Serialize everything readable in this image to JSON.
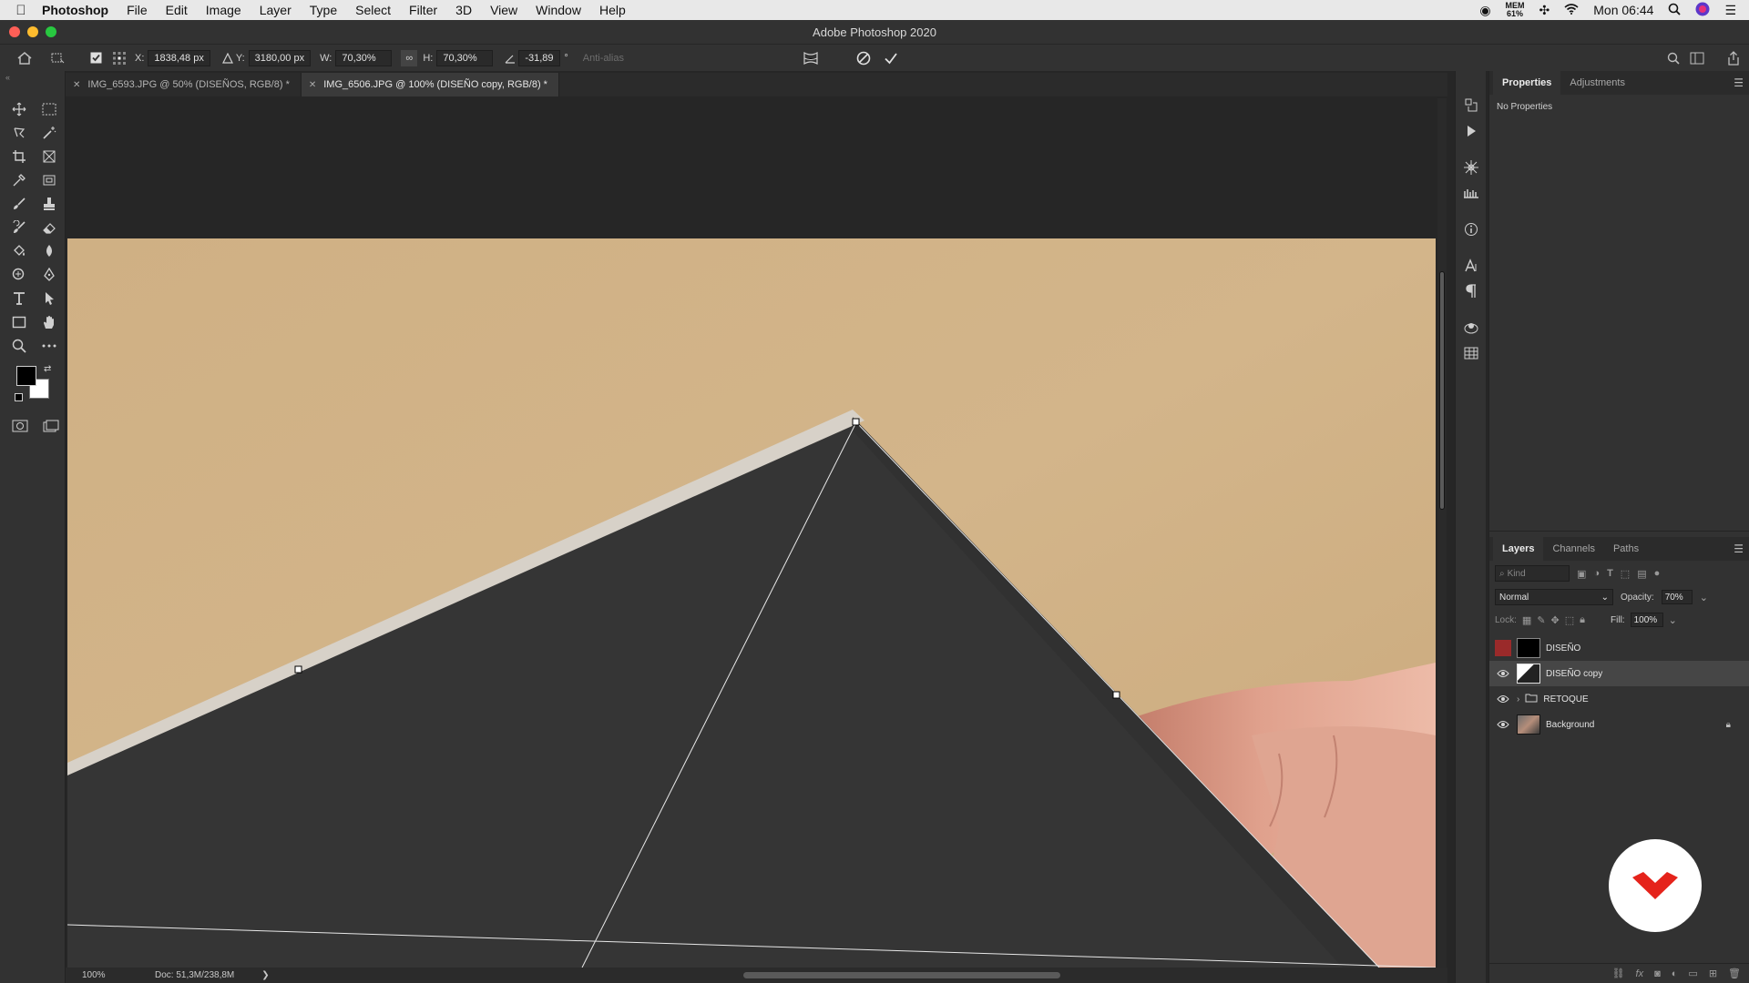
{
  "menubar": {
    "app_name": "Photoshop",
    "items": [
      "File",
      "Edit",
      "Image",
      "Layer",
      "Type",
      "Select",
      "Filter",
      "3D",
      "View",
      "Window",
      "Help"
    ],
    "mem_label": "MEM",
    "mem_value": "61%",
    "clock": "Mon 06:44"
  },
  "window": {
    "title": "Adobe Photoshop 2020"
  },
  "options": {
    "x_label": "X:",
    "x_value": "1838,48 px",
    "y_label": "Y:",
    "y_value": "3180,00 px",
    "w_label": "W:",
    "w_value": "70,30%",
    "h_label": "H:",
    "h_value": "70,30%",
    "angle_value": "-31,89",
    "angle_unit": "°",
    "antialias": "Anti-alias"
  },
  "tabs": [
    {
      "label": "IMG_6593.JPG @ 50% (DISEÑOS, RGB/8) *"
    },
    {
      "label": "IMG_6506.JPG @ 100% (DISEÑO copy, RGB/8) *"
    }
  ],
  "status": {
    "zoom": "100%",
    "doc": "Doc: 51,3M/238,8M",
    "arrow": "❯"
  },
  "properties": {
    "tabs": [
      "Properties",
      "Adjustments"
    ],
    "body": "No Properties"
  },
  "layers_panel": {
    "tabs": [
      "Layers",
      "Channels",
      "Paths"
    ],
    "kind_placeholder": "Kind",
    "blend_mode": "Normal",
    "opacity_label": "Opacity:",
    "opacity_value": "70%",
    "lock_label": "Lock:",
    "fill_label": "Fill:",
    "fill_value": "100%",
    "layers": [
      {
        "name": "DISEÑO"
      },
      {
        "name": "DISEÑO copy"
      },
      {
        "name": "RETOQUE"
      },
      {
        "name": "Background"
      }
    ]
  },
  "colors": {
    "canvas_bg": "#d1b286",
    "shape": "#353535",
    "accent_red": "#e5231b"
  }
}
